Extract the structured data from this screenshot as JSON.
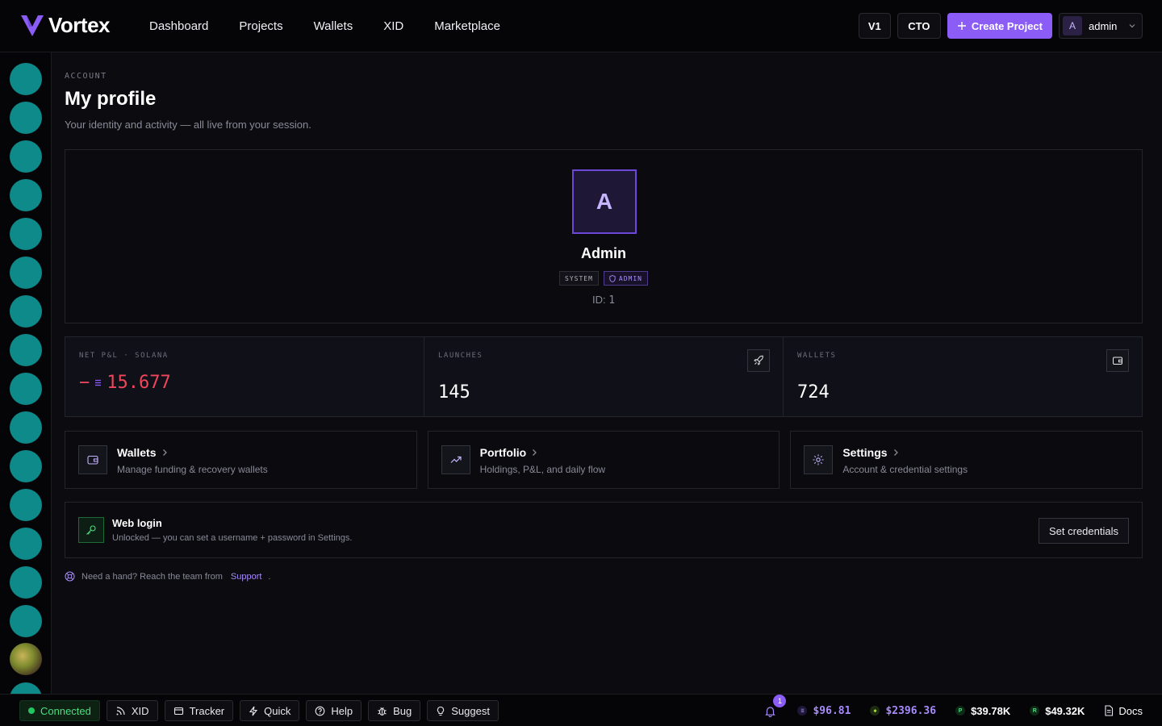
{
  "brand": {
    "name": "Vortex"
  },
  "nav": [
    "Dashboard",
    "Projects",
    "Wallets",
    "XID",
    "Marketplace"
  ],
  "topbar": {
    "v1_label": "V1",
    "cto_label": "CTO",
    "create_label": "Create Project",
    "user_initial": "A",
    "user_name": "admin"
  },
  "page": {
    "eyebrow": "ACCOUNT",
    "title": "My profile",
    "subtitle": "Your identity and activity — all live from your session."
  },
  "profile": {
    "initial": "A",
    "name": "Admin",
    "badge_system": "SYSTEM",
    "badge_admin": "ADMIN",
    "id_label": "ID:",
    "id_value": "1"
  },
  "stats": {
    "pnl": {
      "label": "NET P&L · SOLANA",
      "sign": "−",
      "value": "15.677"
    },
    "launches": {
      "label": "LAUNCHES",
      "value": "145"
    },
    "wallets": {
      "label": "WALLETS",
      "value": "724"
    }
  },
  "links": [
    {
      "title": "Wallets",
      "desc": "Manage funding & recovery wallets"
    },
    {
      "title": "Portfolio",
      "desc": "Holdings, P&L, and daily flow"
    },
    {
      "title": "Settings",
      "desc": "Account & credential settings"
    }
  ],
  "weblogin": {
    "title": "Web login",
    "desc": "Unlocked — you can set a username + password in Settings.",
    "button": "Set credentials"
  },
  "help": {
    "text": "Need a hand? Reach the team from",
    "link": "Support",
    "suffix": "."
  },
  "bottom": {
    "connected": "Connected",
    "buttons": [
      "XID",
      "Tracker",
      "Quick",
      "Help",
      "Bug",
      "Suggest"
    ],
    "notif_count": "1",
    "tickers": [
      {
        "value": "$96.81",
        "color": "#a78bfa"
      },
      {
        "value": "$2396.36",
        "color": "#a78bfa"
      },
      {
        "value": "$39.78K",
        "color": "#ffffff"
      },
      {
        "value": "$49.32K",
        "color": "#ffffff"
      }
    ],
    "docs": "Docs"
  },
  "colors": {
    "accent": "#8b5cf6",
    "negative": "#f0455b",
    "teal": "#0e8a8a",
    "success": "#22c55e"
  }
}
